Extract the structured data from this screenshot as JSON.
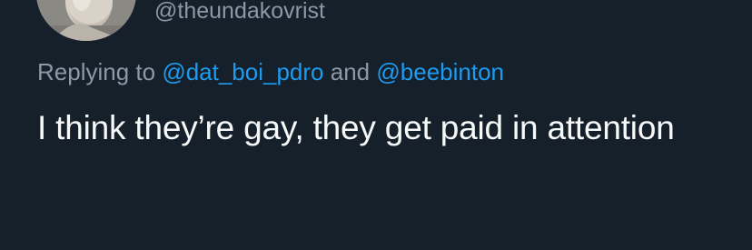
{
  "author": {
    "handle": "@theundakovrist"
  },
  "reply": {
    "prefix": "Replying to",
    "joiner": "and",
    "mentions": [
      "@dat_boi_pdro",
      "@beebinton"
    ]
  },
  "tweet": {
    "text": "I think they’re gay, they get paid in attention"
  },
  "colors": {
    "background": "#15202b",
    "secondary_text": "#8b98a5",
    "link": "#1d9bf0",
    "primary_text": "#f7f9f9"
  }
}
